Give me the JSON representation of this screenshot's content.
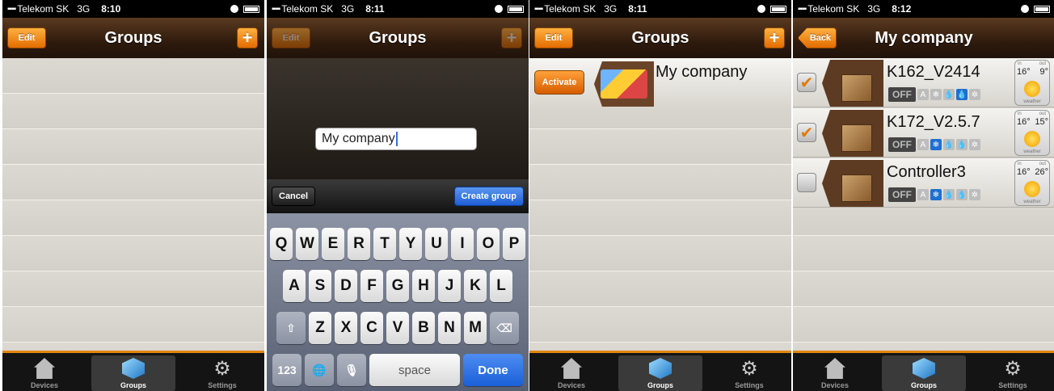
{
  "status_bars": [
    {
      "carrier": "Telekom SK",
      "network": "3G",
      "time": "8:10"
    },
    {
      "carrier": "Telekom SK",
      "network": "3G",
      "time": "8:11"
    },
    {
      "carrier": "Telekom SK",
      "network": "3G",
      "time": "8:11"
    },
    {
      "carrier": "Telekom SK",
      "network": "3G",
      "time": "8:12"
    }
  ],
  "signal_glyph": "▪▪▪▪",
  "screens": {
    "groups": {
      "title": "Groups",
      "edit_label": "Edit",
      "add_label": "+"
    },
    "create_group": {
      "title": "Groups",
      "edit_label": "Edit",
      "add_label": "+",
      "input_value": "My company",
      "cancel_label": "Cancel",
      "create_label": "Create group",
      "keyboard": {
        "row1": [
          "Q",
          "W",
          "E",
          "R",
          "T",
          "Y",
          "U",
          "I",
          "O",
          "P"
        ],
        "row2": [
          "A",
          "S",
          "D",
          "F",
          "G",
          "H",
          "J",
          "K",
          "L"
        ],
        "row3": [
          "Z",
          "X",
          "C",
          "V",
          "B",
          "N",
          "M"
        ],
        "shift": "⇧",
        "delete": "⌫",
        "numbers": "123",
        "globe": "🌐",
        "mic": "🎙",
        "space": "space",
        "done": "Done"
      }
    },
    "groups_list": {
      "title": "Groups",
      "edit_label": "Edit",
      "add_label": "+",
      "group": {
        "activate_label": "Activate",
        "name": "My company"
      }
    },
    "my_company": {
      "title": "My company",
      "back_label": "Back",
      "devices": [
        {
          "name": "K162_V2414",
          "checked": true,
          "off_label": "OFF",
          "in_label": "in",
          "out_label": "out",
          "temp_in": "16°",
          "temp_out": "9°",
          "weather_label": "weather",
          "modes": [
            "A",
            "❄",
            "💧",
            "💧",
            "✲"
          ],
          "active_mode": 3
        },
        {
          "name": "K172_V2.5.7",
          "checked": true,
          "off_label": "OFF",
          "in_label": "in",
          "out_label": "out",
          "temp_in": "16°",
          "temp_out": "15°",
          "weather_label": "weather",
          "modes": [
            "A",
            "❄",
            "💧",
            "💧",
            "✲"
          ],
          "active_mode": 1
        },
        {
          "name": "Controller3",
          "checked": false,
          "off_label": "OFF",
          "in_label": "in",
          "out_label": "out",
          "temp_in": "16°",
          "temp_out": "26°",
          "weather_label": "weather",
          "modes": [
            "A",
            "❄",
            "💧",
            "💧",
            "✲"
          ],
          "active_mode": 1
        }
      ]
    }
  },
  "tabbar": {
    "devices": "Devices",
    "groups": "Groups",
    "settings": "Settings",
    "settings_glyph": "⚙"
  },
  "colors": {
    "accent": "#e3860e",
    "navbar": "#2f1b0d",
    "selected_blue": "#1f6fd0"
  }
}
